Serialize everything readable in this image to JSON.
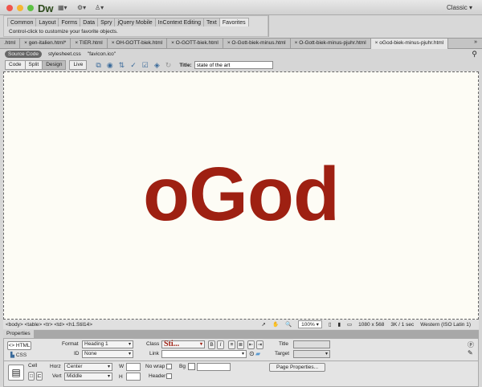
{
  "app": {
    "logo": "Dw",
    "workspace": "Classic"
  },
  "insert_panel": {
    "tabs": [
      "Common",
      "Layout",
      "Forms",
      "Data",
      "Spry",
      "jQuery Mobile",
      "InContext Editing",
      "Text",
      "Favorites"
    ],
    "active": "Favorites",
    "hint": "Control-click to customize your favorite objects."
  },
  "doc_tabs": [
    ".html",
    "gen-italien.html*",
    "TIER.html",
    "OH-GOTT-biek.html",
    "O-GOTT-biek.html",
    "O-Gott-biek-minus.html",
    "O-Gott-biek-minus-pjuhr.html",
    "oGod-biek-minus-pjuhr.html"
  ],
  "related_files": {
    "source": "Source Code",
    "files": [
      "stylesheet.css",
      "\"favicon.ico\""
    ]
  },
  "doc_toolbar": {
    "views": [
      "Code",
      "Split",
      "Design"
    ],
    "live": "Live",
    "title_label": "Title:",
    "title_value": "state of the art"
  },
  "design": {
    "heading": "oGod",
    "heading_color": "#9e2012"
  },
  "status": {
    "tags": "<body> <table> <tr> <td> <h1.Stil14>",
    "zoom": "100%",
    "size": "1080 x 568",
    "download": "3K / 1 sec",
    "encoding": "Western (ISO Latin 1)"
  },
  "properties": {
    "title": "Properties",
    "html": "HTML",
    "css": "CSS",
    "format_label": "Format",
    "format": "Heading 1",
    "id_label": "ID",
    "id": "None",
    "class_label": "Class",
    "class": "Sti...",
    "link_label": "Link",
    "title_field_label": "Title",
    "target_label": "Target",
    "cell": "Cell",
    "horz_label": "Horz",
    "horz": "Center",
    "vert_label": "Vert",
    "vert": "Middle",
    "w": "W",
    "h": "H",
    "nowrap": "No wrap",
    "bg": "Bg",
    "header": "Header",
    "page_props": "Page Properties..."
  }
}
